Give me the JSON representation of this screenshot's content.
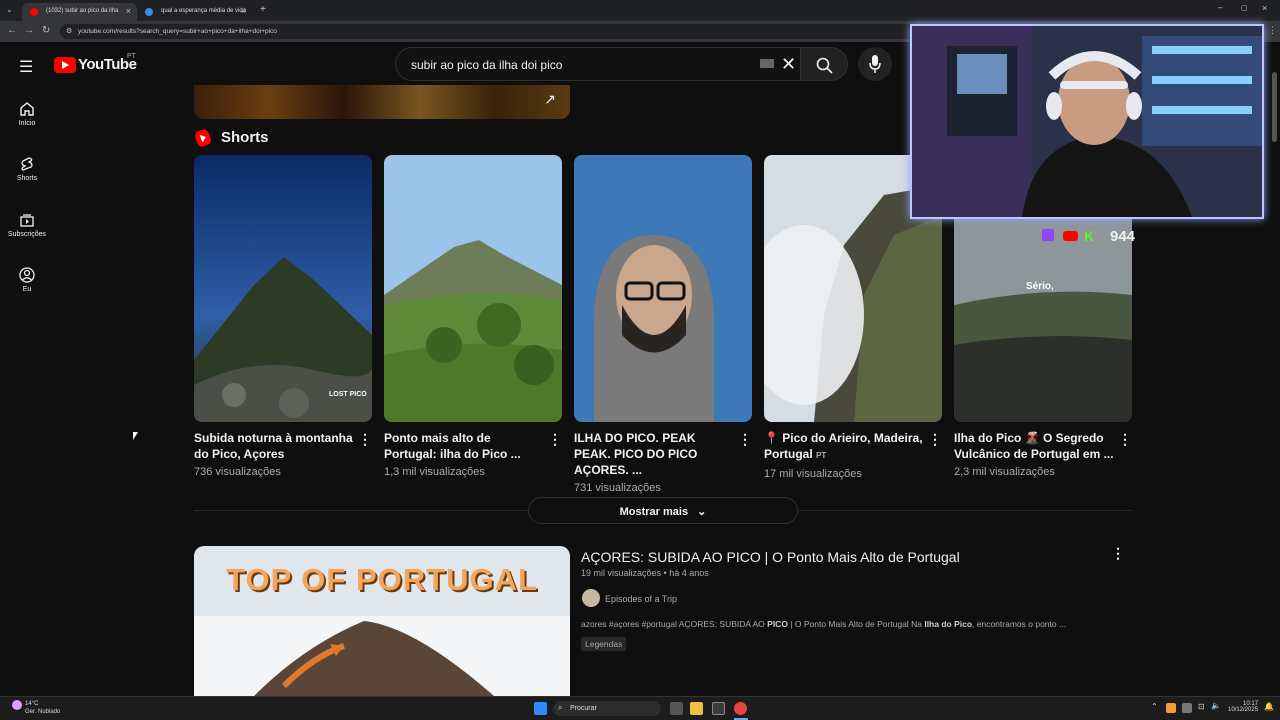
{
  "browser": {
    "tabs": [
      {
        "label": "(1032) subir ao pico da ilha",
        "active": true
      },
      {
        "label": "qual a esperança média de vida",
        "active": false
      }
    ],
    "url": "youtube.com/results?search_query=subir+ao+pico+da+ilha+doi+pico"
  },
  "youtube": {
    "logo_text": "YouTube",
    "region": "PT",
    "search_value": "subir ao pico da ilha doi pico",
    "sidebar": [
      {
        "label": "Início",
        "icon": "home-icon"
      },
      {
        "label": "Shorts",
        "icon": "shorts-icon"
      },
      {
        "label": "Subscrições",
        "icon": "subscriptions-icon"
      },
      {
        "label": "Eu",
        "icon": "user-icon"
      }
    ],
    "shorts_header": "Shorts",
    "shorts": [
      {
        "title": "Subida noturna à montanha do Pico, Açores",
        "views": "736 visualizações",
        "watermark": "LOST PICO"
      },
      {
        "title": "Ponto mais alto de Portugal: ilha do Pico ...",
        "views": "1,3 mil visualizações"
      },
      {
        "title": "ILHA DO PICO. PEAK PEAK. PICO DO PICO AÇORES. ...",
        "views": "731 visualizações"
      },
      {
        "title": "📍 Pico do Arieiro, Madeira, Portugal",
        "badge": "PT",
        "views": "17 mil visualizações"
      },
      {
        "title": "Ilha do Pico 🌋 O Segredo Vulcânico de Portugal em ...",
        "views": "2,3 mil visualizações",
        "overlay": "Sério,"
      }
    ],
    "show_more": "Mostrar mais",
    "video": {
      "thumb_text": "TOP OF PORTUGAL",
      "title": "AÇORES: SUBIDA AO PICO | O Ponto Mais Alto de Portugal",
      "views": "19 mil visualizações",
      "age": "há 4 anos",
      "channel": "Episodes of a Trip",
      "desc_plain1": "azores #açores #portugal AÇORES: SUBIDA AO ",
      "desc_bold1": "PICO",
      "desc_plain2": " | O Ponto Mais Alto de Portugal Na ",
      "desc_bold2": "Ilha do Pico",
      "desc_plain3": ", encontramos o ponto ...",
      "badge": "Legendas"
    }
  },
  "stream": {
    "follower_count": "944"
  },
  "taskbar": {
    "weather_temp": "14°C",
    "weather_desc": "Ger. Nublado",
    "search_placeholder": "Procurar",
    "time": "10:17",
    "date": "10/12/2025"
  },
  "colors": {
    "youtube_red": "#ff0000",
    "background": "#0f0f0f",
    "webcam_border": "#b9c6ff"
  }
}
